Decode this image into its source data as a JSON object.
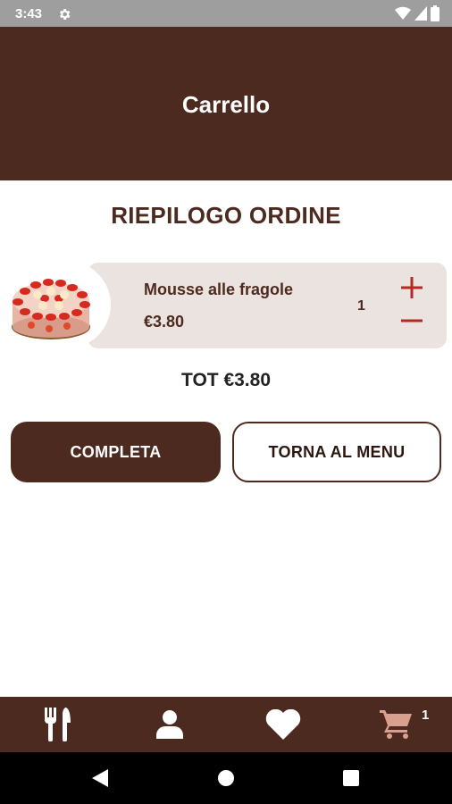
{
  "status_bar": {
    "time": "3:43",
    "icons": [
      "settings-icon",
      "wifi-icon",
      "signal-icon",
      "battery-icon"
    ]
  },
  "app_bar": {
    "title": "Carrello"
  },
  "summary": {
    "title": "RIEPILOGO ORDINE"
  },
  "cart": {
    "items": [
      {
        "name": "Mousse alle fragole",
        "price": "€3.80",
        "quantity": "1",
        "image": "strawberry-mousse-cake"
      }
    ]
  },
  "total": {
    "label": "TOT €3.80"
  },
  "actions": {
    "complete_label": "COMPLETA",
    "back_label": "TORNA AL MENU"
  },
  "bottom_nav": {
    "items": [
      {
        "icon": "utensils-icon"
      },
      {
        "icon": "user-icon"
      },
      {
        "icon": "heart-icon"
      },
      {
        "icon": "cart-icon",
        "badge": "1"
      }
    ]
  },
  "colors": {
    "primary": "#4c2a1f",
    "item_background": "#ebe3e0",
    "accent_red": "#b52a22",
    "cart_icon": "#d9a08f",
    "status_bar": "#9e9e9e"
  }
}
